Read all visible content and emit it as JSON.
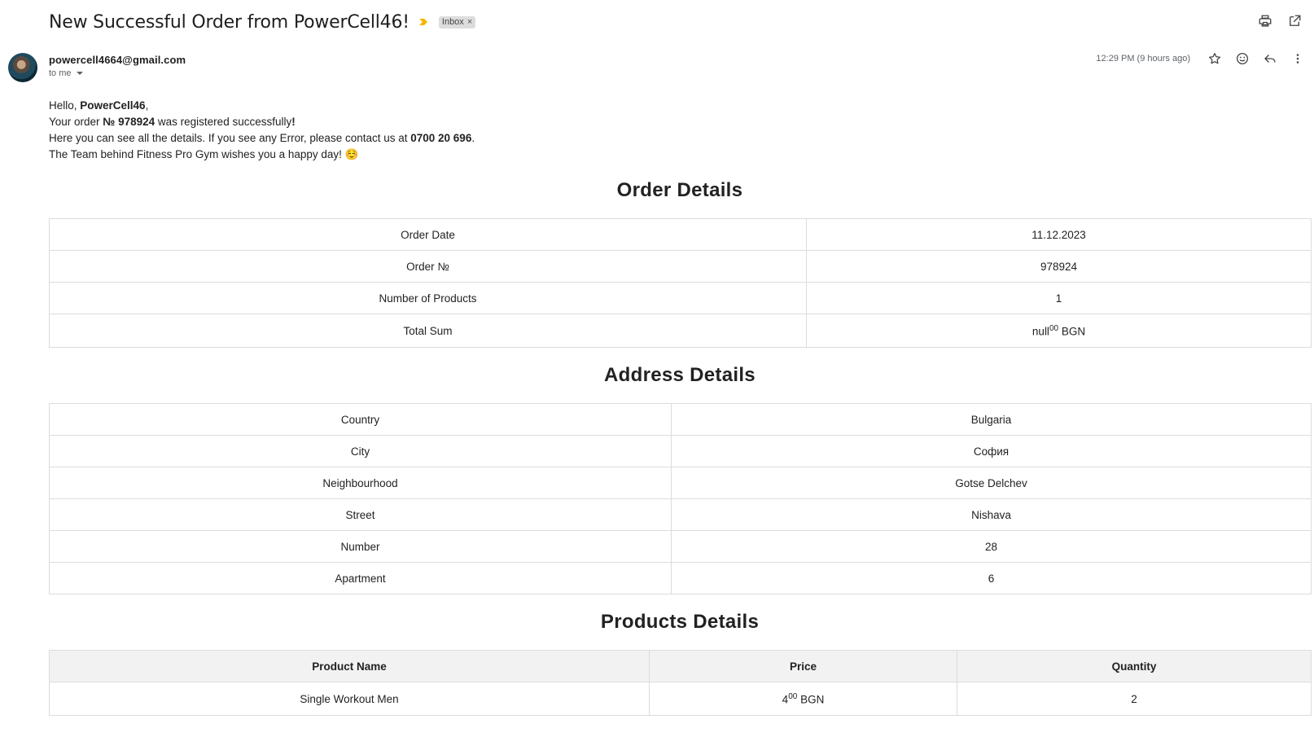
{
  "email": {
    "subject": "New Successful Order from PowerCell46!",
    "label": "Inbox",
    "label_close": "×",
    "sender": "powercell4664@gmail.com",
    "recipient": "to me",
    "timestamp": "12:29 PM (9 hours ago)"
  },
  "greeting": {
    "hello_prefix": "Hello, ",
    "username": "PowerCell46",
    "hello_suffix": ",",
    "order_prefix": "Your order ",
    "order_no": "№ 978924",
    "order_suffix": " was registered successfully",
    "order_bang": "!",
    "details_prefix": "Here you can see all the details. If you see any Error, please contact us at ",
    "phone": "0700 20 696",
    "details_suffix": ".",
    "team_line": "The Team behind Fitness Pro Gym wishes you a happy day! ☺️"
  },
  "order_details": {
    "title": "Order Details",
    "rows": [
      {
        "label": "Order Date",
        "value": "11.12.2023"
      },
      {
        "label": "Order №",
        "value": "978924"
      },
      {
        "label": "Number of Products",
        "value": "1"
      },
      {
        "label": "Total Sum",
        "value_main": "null",
        "value_sup": "00",
        "value_unit": " BGN"
      }
    ]
  },
  "address_details": {
    "title": "Address Details",
    "rows": [
      {
        "label": "Country",
        "value": "Bulgaria"
      },
      {
        "label": "City",
        "value": "София"
      },
      {
        "label": "Neighbourhood",
        "value": "Gotse Delchev"
      },
      {
        "label": "Street",
        "value": "Nishava"
      },
      {
        "label": "Number",
        "value": "28"
      },
      {
        "label": "Apartment",
        "value": "6"
      }
    ]
  },
  "products_details": {
    "title": "Products Details",
    "headers": [
      "Product Name",
      "Price",
      "Quantity"
    ],
    "rows": [
      {
        "name": "Single Workout Men",
        "price_main": "4",
        "price_sup": "00",
        "price_unit": " BGN",
        "quantity": "2"
      }
    ]
  },
  "icons": {
    "importance": "importance-marker-icon",
    "print": "print-icon",
    "open_new_window": "open-in-new-window-icon",
    "star": "star-icon",
    "emoji": "emoji-react-icon",
    "reply": "reply-icon",
    "more": "more-vert-icon"
  },
  "colors": {
    "importance": "#f4b400",
    "label_bg": "#dddddd",
    "table_border": "#dcdcdc",
    "header_bg": "#f2f2f2"
  }
}
